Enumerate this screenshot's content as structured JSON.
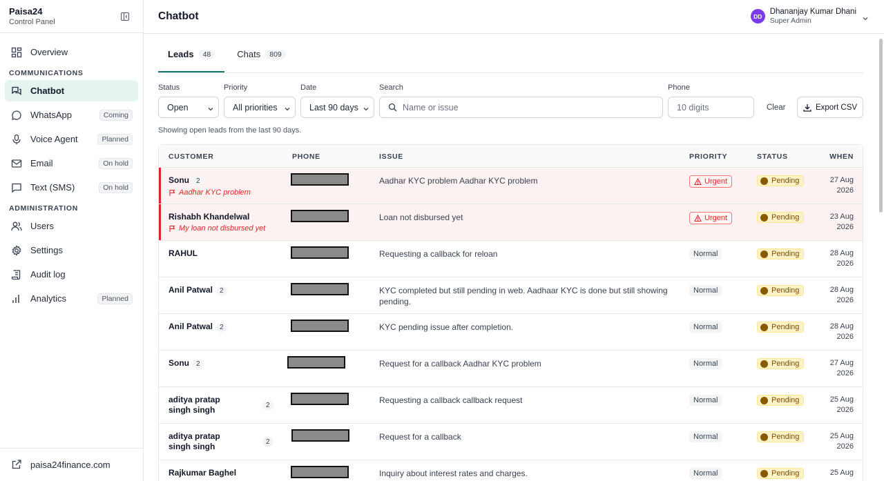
{
  "brand": {
    "name": "Paisa24",
    "subtitle": "Control Panel"
  },
  "nav": {
    "overview": "Overview",
    "section_communications": "COMMUNICATIONS",
    "chatbot": "Chatbot",
    "whatsapp": "WhatsApp",
    "whatsapp_badge": "Coming",
    "voice_agent": "Voice Agent",
    "voice_agent_badge": "Planned",
    "email": "Email",
    "email_badge": "On hold",
    "sms": "Text (SMS)",
    "sms_badge": "On hold",
    "section_administration": "ADMINISTRATION",
    "users": "Users",
    "settings": "Settings",
    "audit_log": "Audit log",
    "analytics": "Analytics",
    "analytics_badge": "Planned",
    "footer_link": "paisa24finance.com"
  },
  "header": {
    "title": "Chatbot",
    "user_initials": "DD",
    "user_name": "Dhananjay Kumar Dhani",
    "user_role": "Super Admin"
  },
  "tabs": [
    {
      "label": "Leads",
      "count": "48"
    },
    {
      "label": "Chats",
      "count": "809"
    }
  ],
  "filters": {
    "status_label": "Status",
    "status_value": "Open",
    "priority_label": "Priority",
    "priority_value": "All priorities",
    "date_label": "Date",
    "date_value": "Last 90 days",
    "search_label": "Search",
    "search_placeholder": "Name or issue",
    "phone_label": "Phone",
    "phone_placeholder": "10 digits",
    "clear": "Clear",
    "export": "Export CSV"
  },
  "showing_text": "Showing open leads from the last 90 days.",
  "table": {
    "headers": [
      "CUSTOMER",
      "PHONE",
      "ISSUE",
      "PRIORITY",
      "STATUS",
      "WHEN"
    ],
    "rows": [
      {
        "name": "Sonu",
        "count": "2",
        "flag": "Aadhar KYC problem",
        "issue": "Aadhar KYC problem Aadhar KYC problem",
        "priority": "Urgent",
        "status": "Pending",
        "when1": "27 Aug",
        "when2": "2026"
      },
      {
        "name": "Rishabh Khandelwal",
        "count": "",
        "flag": "My loan not disbursed yet",
        "issue": "Loan not disbursed yet",
        "priority": "Urgent",
        "status": "Pending",
        "when1": "23 Aug",
        "when2": "2026"
      },
      {
        "name": "RAHUL",
        "count": "",
        "flag": "",
        "issue": "Requesting a callback for reloan",
        "priority": "Normal",
        "status": "Pending",
        "when1": "28 Aug",
        "when2": "2026"
      },
      {
        "name": "Anil Patwal",
        "count": "2",
        "flag": "",
        "issue": "KYC completed but still pending in web. Aadhaar KYC is done but still showing pending.",
        "priority": "Normal",
        "status": "Pending",
        "when1": "28 Aug",
        "when2": "2026"
      },
      {
        "name": "Anil Patwal",
        "count": "2",
        "flag": "",
        "issue": "KYC pending issue after completion.",
        "priority": "Normal",
        "status": "Pending",
        "when1": "28 Aug",
        "when2": "2026"
      },
      {
        "name": "Sonu",
        "count": "2",
        "flag": "",
        "issue": "Request for a callback Aadhar KYC problem",
        "priority": "Normal",
        "status": "Pending",
        "when1": "27 Aug",
        "when2": "2026"
      },
      {
        "name": "aditya pratap singh singh",
        "count": "2",
        "flag": "",
        "issue": "Requesting a callback callback request",
        "priority": "Normal",
        "status": "Pending",
        "when1": "25 Aug",
        "when2": "2026"
      },
      {
        "name": "aditya pratap singh singh",
        "count": "2",
        "flag": "",
        "issue": "Request for a callback",
        "priority": "Normal",
        "status": "Pending",
        "when1": "25 Aug",
        "when2": "2026"
      },
      {
        "name": "Rajkumar Baghel",
        "count": "",
        "flag": "",
        "issue": "Inquiry about interest rates and charges.",
        "priority": "Normal",
        "status": "Pending",
        "when1": "25 Aug",
        "when2": ""
      }
    ]
  }
}
